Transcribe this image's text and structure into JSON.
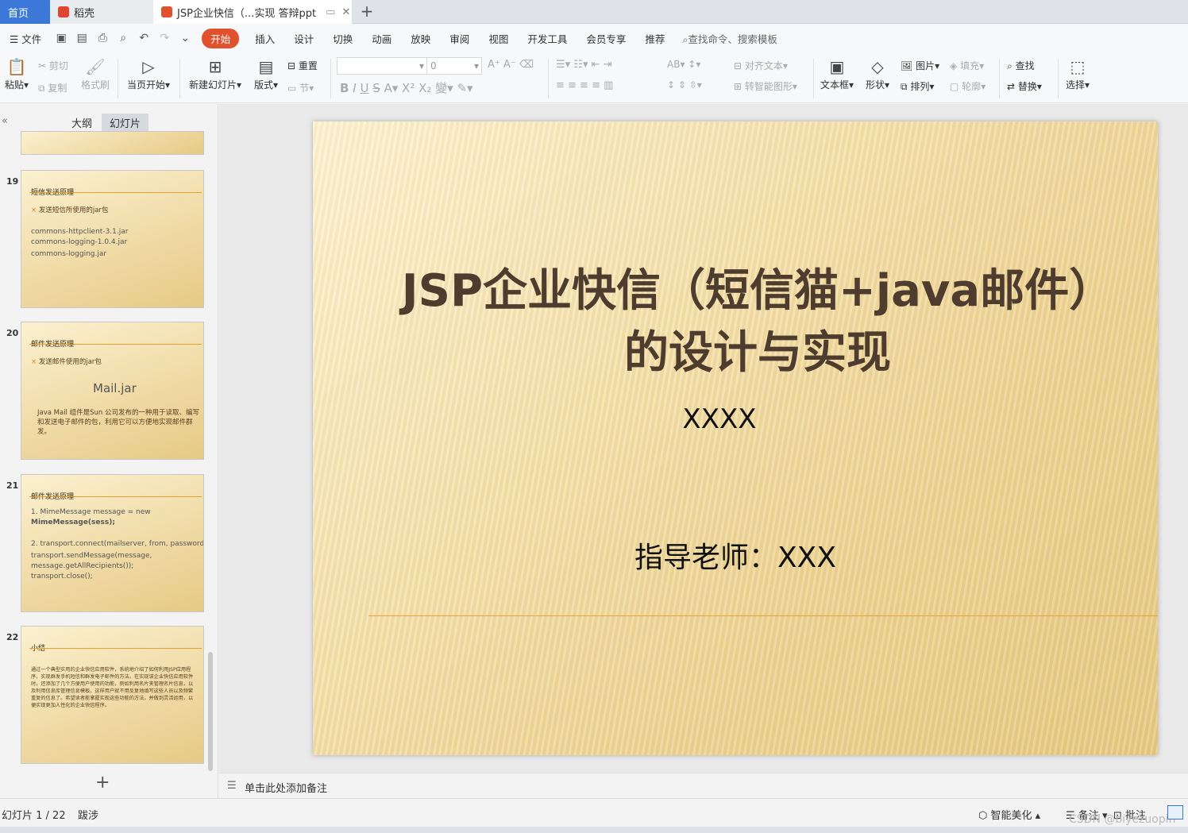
{
  "tabs": {
    "home": "首页",
    "daoke": "稻壳",
    "doc": "JSP企业快信（...实现 答辩ppt",
    "new": "+"
  },
  "menu": {
    "file": "文件",
    "items": [
      "开始",
      "插入",
      "设计",
      "切换",
      "动画",
      "放映",
      "审阅",
      "视图",
      "开发工具",
      "会员专享",
      "推荐"
    ],
    "search": "查找命令、搜索模板"
  },
  "ribbon": {
    "paste": "粘贴",
    "cut": "剪切",
    "copy": "复制",
    "format_painter": "格式刷",
    "from_current": "当页开始",
    "new_slide": "新建幻灯片",
    "layout": "版式",
    "reset": "重置",
    "section": "节",
    "font_size": "0",
    "align_text": "对齐文本",
    "smart_art": "转智能图形",
    "textbox": "文本框",
    "shape": "形状",
    "picture": "图片",
    "arrange": "排列",
    "fill": "填充",
    "outline": "轮廓",
    "find": "查找",
    "replace": "替换",
    "select": "选择"
  },
  "panel": {
    "outline_tab": "大纲",
    "slides_tab": "幻灯片",
    "add": "+"
  },
  "thumbs": [
    {
      "num": "19",
      "title": "短信发送原理",
      "bullet": "发送短信所使用的jar包",
      "lines": [
        "commons-httpclient-3.1.jar",
        "commons-logging-1.0.4.jar",
        "commons-logging.jar"
      ]
    },
    {
      "num": "20",
      "title": "邮件发送原理",
      "bullet": "发送邮件使用的jar包",
      "big": "Mail.jar",
      "para": "Java Mail 组件是Sun 公司发布的一种用于读取、编写和发送电子邮件的包，利用它可以方便地实现邮件群发。"
    },
    {
      "num": "21",
      "title": "邮件发送原理",
      "lines": [
        "1. MimeMessage message = new",
        "MimeMessage(sess);",
        "",
        "2. transport.connect(mailserver, from, password);",
        "transport.sendMessage(message,",
        "message.getAllRecipients());",
        "transport.close();"
      ]
    },
    {
      "num": "22",
      "title": "小结",
      "para": "通过一个典型实用的企业快信应用软件，系统地介绍了如何利用JSP应用程序，实现群发手机短信和群发电子邮件的方法。在实现该企业快信应用软件时，还添加了几个方便用户使用的功能，例如利用名片夹管理名片信息，以及利用信息库管理信息模板。这样用户就不用反复地填写这些人员以及频繁重复的信息了。希望读者能掌握实现这些功能的方法，并做到灵活运用，以便实现更加人性化的企业快信程序。"
    }
  ],
  "slide": {
    "title_line1": "JSP企业快信（短信猫+java邮件）",
    "title_line2": "的设计与实现",
    "author": "XXXX",
    "advisor": "指导老师：XXX"
  },
  "notes": {
    "placeholder": "单击此处添加备注"
  },
  "status": {
    "slide_count": "幻灯片 1 / 22",
    "theme": "跋涉",
    "beautify": "智能美化",
    "notes": "备注",
    "comment": "批注",
    "watermark": "CSDN @biyezuopin"
  }
}
